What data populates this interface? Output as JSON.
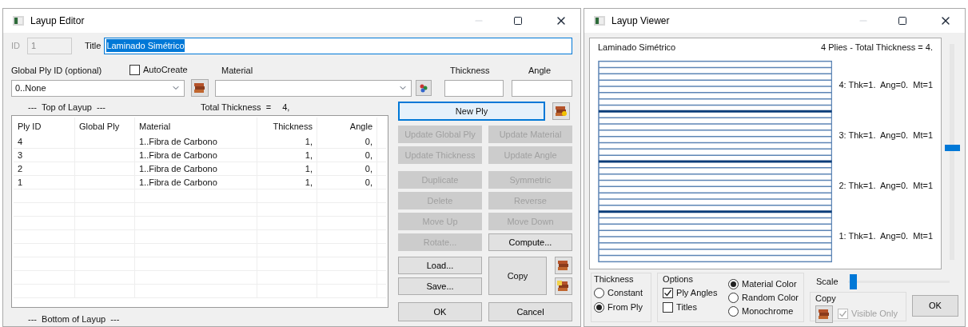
{
  "editor": {
    "title": "Layup Editor",
    "id_label": "ID",
    "id_value": "1",
    "title_label": "Title",
    "title_value": "Laminado Simétrico",
    "global_ply_label": "Global Ply ID (optional)",
    "autocreate": {
      "label": "AutoCreate",
      "checked": false
    },
    "global_ply_value": "0..None",
    "material_label": "Material",
    "thickness_label": "Thickness",
    "angle_label": "Angle",
    "top_label": "---  Top of Layup  ---",
    "total_label": "Total Thickness  =",
    "total_value": "4,",
    "bottom_label": "---  Bottom of Layup  ---",
    "table": {
      "columns": [
        "Ply ID",
        "Global Ply",
        "Material",
        "Thickness",
        "Angle"
      ],
      "rows": [
        [
          "4",
          "",
          "1..Fibra de Carbono",
          "1,",
          "0,"
        ],
        [
          "3",
          "",
          "1..Fibra de Carbono",
          "1,",
          "0,"
        ],
        [
          "2",
          "",
          "1..Fibra de Carbono",
          "1,",
          "0,"
        ],
        [
          "1",
          "",
          "1..Fibra de Carbono",
          "1,",
          "0,"
        ]
      ]
    },
    "new_ply": "New Ply",
    "button_groups": [
      [
        [
          {
            "label": "Update Global Ply",
            "disabled": true
          },
          {
            "label": "Update Material",
            "disabled": true
          }
        ],
        [
          {
            "label": "Update Thickness",
            "disabled": true
          },
          {
            "label": "Update Angle",
            "disabled": true
          }
        ]
      ],
      [
        [
          {
            "label": "Duplicate",
            "disabled": true
          },
          {
            "label": "Symmetric",
            "disabled": true
          }
        ],
        [
          {
            "label": "Delete",
            "disabled": true
          },
          {
            "label": "Reverse",
            "disabled": true
          }
        ],
        [
          {
            "label": "Move Up",
            "disabled": true
          },
          {
            "label": "Move Down",
            "disabled": true
          }
        ],
        [
          {
            "label": "Rotate...",
            "disabled": true
          },
          {
            "label": "Compute...",
            "disabled": false
          }
        ]
      ]
    ],
    "load": "Load...",
    "save": "Save...",
    "copy": "Copy",
    "ok": "OK",
    "cancel": "Cancel"
  },
  "viewer": {
    "title": "Layup Viewer",
    "laminate_title": "Laminado Simétrico",
    "summary": "4 Plies - Total Thickness = 4.",
    "ply_labels": [
      "4: Thk=1.  Ang=0.  Mt=1",
      "3: Thk=1.  Ang=0.  Mt=1",
      "2: Thk=1.  Ang=0.  Mt=1",
      "1: Thk=1.  Ang=0.  Mt=1"
    ],
    "thickness": {
      "title": "Thickness",
      "options": [
        {
          "label": "Constant",
          "selected": false
        },
        {
          "label": "From Ply",
          "selected": true
        }
      ]
    },
    "options": {
      "title": "Options",
      "checks": [
        {
          "label": "Ply Angles",
          "checked": true
        },
        {
          "label": "Titles",
          "checked": false
        }
      ],
      "colors": [
        {
          "label": "Material Color",
          "selected": true
        },
        {
          "label": "Random Color",
          "selected": false
        },
        {
          "label": "Monochrome",
          "selected": false
        }
      ]
    },
    "scale": {
      "label": "Scale",
      "level": 0.02
    },
    "copy": {
      "title": "Copy",
      "visible_only": {
        "label": "Visible Only",
        "checked": true,
        "disabled": true
      }
    },
    "ok": "OK"
  }
}
